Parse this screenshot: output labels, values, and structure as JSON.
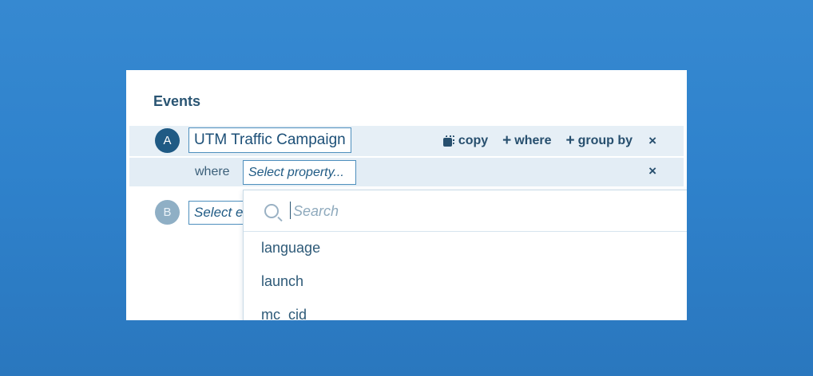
{
  "events": {
    "title": "Events",
    "row_a": {
      "badge": "A",
      "event_name": "UTM Traffic Campaign",
      "actions": {
        "copy": "copy",
        "where": "where",
        "group_by": "group by",
        "close": "×"
      }
    },
    "where_row": {
      "label": "where",
      "property_placeholder": "Select property...",
      "close": "×"
    },
    "row_b": {
      "badge": "B",
      "event_placeholder": "Select e"
    }
  },
  "dropdown": {
    "search_placeholder": "Search",
    "options": [
      "language",
      "launch",
      "mc_cid"
    ]
  },
  "icons": {
    "copy": "copy-icon",
    "plus": "plus-icon",
    "close": "close-icon",
    "search": "search-icon"
  }
}
